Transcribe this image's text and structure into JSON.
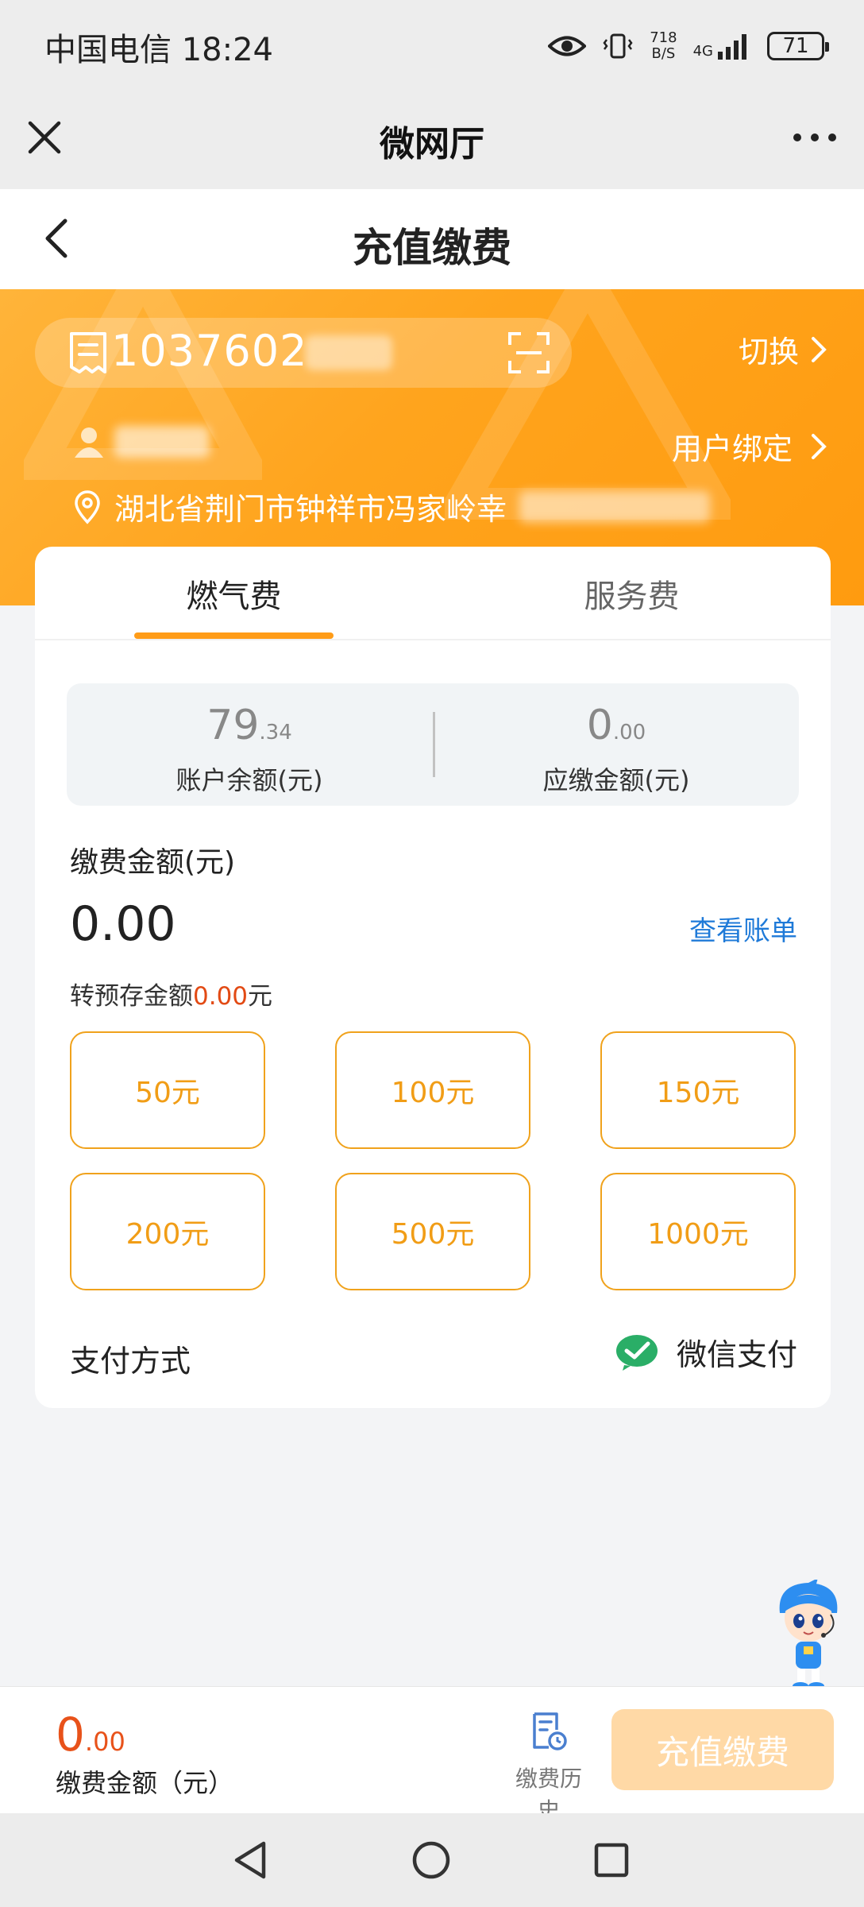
{
  "status_bar": {
    "carrier_time": "中国电信 18:24",
    "speed_value": "718",
    "speed_unit": "B/S",
    "network": "4G",
    "battery": "71"
  },
  "wechat": {
    "title": "微网厅"
  },
  "page": {
    "title": "充值缴费"
  },
  "account": {
    "number": "1037602",
    "switch_label": "切换",
    "bind_label": "用户绑定",
    "address": "湖北省荆门市钟祥市冯家岭幸"
  },
  "tabs": [
    {
      "label": "燃气费",
      "active": true
    },
    {
      "label": "服务费",
      "active": false
    }
  ],
  "balance": {
    "account": {
      "int": "79",
      "dec": ".34",
      "label": "账户余额(元)"
    },
    "due": {
      "int": "0",
      "dec": ".00",
      "label": "应缴金额(元)"
    }
  },
  "payment": {
    "label": "缴费金额(元)",
    "amount": "0.00",
    "view_bill": "查看账单",
    "prestore_prefix": "转预存金额",
    "prestore_value": "0.00",
    "prestore_suffix": "元"
  },
  "amount_options": [
    "50元",
    "100元",
    "150元",
    "200元",
    "500元",
    "1000元"
  ],
  "pay_method": {
    "label": "支付方式",
    "value": "微信支付"
  },
  "bottom": {
    "amount_int": "0",
    "amount_dec": ".00",
    "amount_label": "缴费金额（元）",
    "history_label": "缴费历史",
    "submit_label": "充值缴费"
  },
  "colors": {
    "accent": "#ff9c18",
    "amount_red": "#e8521a",
    "link_blue": "#1f7ad8",
    "wechat_green": "#2aae67"
  }
}
